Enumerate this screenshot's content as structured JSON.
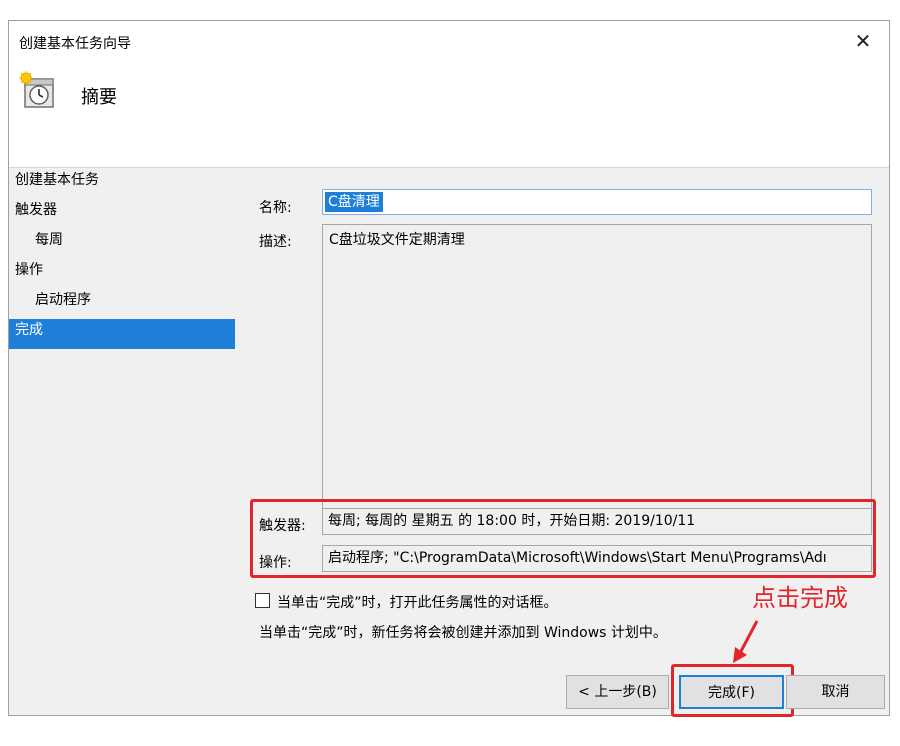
{
  "window": {
    "title": "创建基本任务向导",
    "close_glyph": "✕"
  },
  "header": {
    "title": "摘要",
    "icon": "clock-calendar-icon"
  },
  "steps": [
    {
      "label": "创建基本任务",
      "sub": false,
      "selected": false
    },
    {
      "label": "触发器",
      "sub": false,
      "selected": false
    },
    {
      "label": "每周",
      "sub": true,
      "selected": false
    },
    {
      "label": "操作",
      "sub": false,
      "selected": false
    },
    {
      "label": "启动程序",
      "sub": true,
      "selected": false
    },
    {
      "label": "完成",
      "sub": false,
      "selected": true
    }
  ],
  "form": {
    "name_label": "名称:",
    "name_value": "C盘清理",
    "desc_label": "描述:",
    "desc_value": "C盘垃圾文件定期清理",
    "trigger_label": "触发器:",
    "trigger_value": "每周; 每周的 星期五 的 18:00 时，开始日期: 2019/10/11",
    "action_label": "操作:",
    "action_value": "启动程序; \"C:\\ProgramData\\Microsoft\\Windows\\Start Menu\\Programs\\Adı"
  },
  "options": {
    "open_properties_label": "当单击“完成”时，打开此任务属性的对话框。",
    "open_properties_checked": false,
    "info_text": "当单击“完成”时，新任务将会被创建并添加到 Windows 计划中。"
  },
  "buttons": {
    "back": "< 上一步(B)",
    "finish": "完成(F)",
    "cancel": "取消"
  },
  "annotation": {
    "text": "点击完成",
    "color": "#e2252b"
  },
  "colors": {
    "selection": "#1e7fd8",
    "highlight": "#e2252b"
  }
}
